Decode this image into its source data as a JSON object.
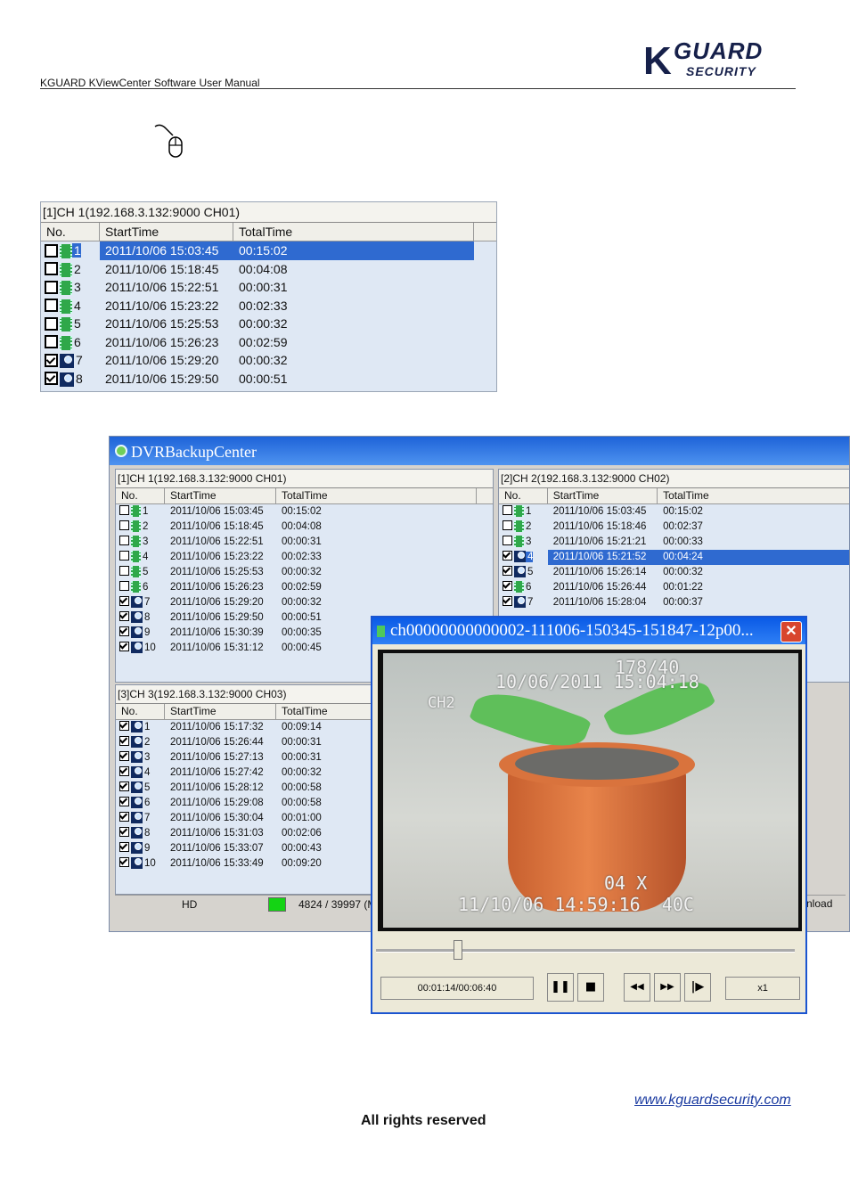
{
  "header": {
    "title": "KGUARD KViewCenter Software User Manual",
    "logo_main": "K",
    "logo_guard": "GUARD",
    "logo_security": "SECURITY"
  },
  "icons": {
    "mouse": "mouse-icon"
  },
  "list_panel": {
    "title": "[1]CH 1(192.168.3.132:9000 CH01)",
    "columns": [
      "No.",
      "StartTime",
      "TotalTime"
    ],
    "rows": [
      {
        "no": "1",
        "start": "2011/10/06 15:03:45",
        "total": "00:15:02",
        "checked": false,
        "icon": "film",
        "selected": true
      },
      {
        "no": "2",
        "start": "2011/10/06 15:18:45",
        "total": "00:04:08",
        "checked": false,
        "icon": "film"
      },
      {
        "no": "3",
        "start": "2011/10/06 15:22:51",
        "total": "00:00:31",
        "checked": false,
        "icon": "film"
      },
      {
        "no": "4",
        "start": "2011/10/06 15:23:22",
        "total": "00:02:33",
        "checked": false,
        "icon": "film"
      },
      {
        "no": "5",
        "start": "2011/10/06 15:25:53",
        "total": "00:00:32",
        "checked": false,
        "icon": "film"
      },
      {
        "no": "6",
        "start": "2011/10/06 15:26:23",
        "total": "00:02:59",
        "checked": false,
        "icon": "film"
      },
      {
        "no": "7",
        "start": "2011/10/06 15:29:20",
        "total": "00:00:32",
        "checked": true,
        "icon": "mag"
      },
      {
        "no": "8",
        "start": "2011/10/06 15:29:50",
        "total": "00:00:51",
        "checked": true,
        "icon": "mag"
      }
    ]
  },
  "dvr": {
    "title": "DVRBackupCenter",
    "ch1": {
      "title": "[1]CH 1(192.168.3.132:9000 CH01)",
      "columns": [
        "No.",
        "StartTime",
        "TotalTime"
      ],
      "rows": [
        [
          "1",
          "2011/10/06 15:03:45",
          "00:15:02",
          false,
          "film"
        ],
        [
          "2",
          "2011/10/06 15:18:45",
          "00:04:08",
          false,
          "film"
        ],
        [
          "3",
          "2011/10/06 15:22:51",
          "00:00:31",
          false,
          "film"
        ],
        [
          "4",
          "2011/10/06 15:23:22",
          "00:02:33",
          false,
          "film"
        ],
        [
          "5",
          "2011/10/06 15:25:53",
          "00:00:32",
          false,
          "film"
        ],
        [
          "6",
          "2011/10/06 15:26:23",
          "00:02:59",
          false,
          "film"
        ],
        [
          "7",
          "2011/10/06 15:29:20",
          "00:00:32",
          true,
          "mag"
        ],
        [
          "8",
          "2011/10/06 15:29:50",
          "00:00:51",
          true,
          "mag"
        ],
        [
          "9",
          "2011/10/06 15:30:39",
          "00:00:35",
          true,
          "mag"
        ],
        [
          "10",
          "2011/10/06 15:31:12",
          "00:00:45",
          true,
          "mag"
        ]
      ]
    },
    "ch2": {
      "title": "[2]CH 2(192.168.3.132:9000 CH02)",
      "columns": [
        "No.",
        "StartTime",
        "TotalTime"
      ],
      "rows": [
        [
          "1",
          "2011/10/06 15:03:45",
          "00:15:02",
          false,
          "film"
        ],
        [
          "2",
          "2011/10/06 15:18:46",
          "00:02:37",
          false,
          "film"
        ],
        [
          "3",
          "2011/10/06 15:21:21",
          "00:00:33",
          false,
          "film"
        ],
        [
          "4",
          "2011/10/06 15:21:52",
          "00:04:24",
          true,
          "mag"
        ],
        [
          "5",
          "2011/10/06 15:26:14",
          "00:00:32",
          true,
          "mag"
        ],
        [
          "6",
          "2011/10/06 15:26:44",
          "00:01:22",
          true,
          "film"
        ],
        [
          "7",
          "2011/10/06 15:28:04",
          "00:00:37",
          true,
          "mag"
        ]
      ]
    },
    "ch3": {
      "title": "[3]CH 3(192.168.3.132:9000 CH03)",
      "columns": [
        "No.",
        "StartTime",
        "TotalTime"
      ],
      "rows": [
        [
          "1",
          "2011/10/06 15:17:32",
          "00:09:14",
          true,
          "mag"
        ],
        [
          "2",
          "2011/10/06 15:26:44",
          "00:00:31",
          true,
          "mag"
        ],
        [
          "3",
          "2011/10/06 15:27:13",
          "00:00:31",
          true,
          "mag"
        ],
        [
          "4",
          "2011/10/06 15:27:42",
          "00:00:32",
          true,
          "mag"
        ],
        [
          "5",
          "2011/10/06 15:28:12",
          "00:00:58",
          true,
          "mag"
        ],
        [
          "6",
          "2011/10/06 15:29:08",
          "00:00:58",
          true,
          "mag"
        ],
        [
          "7",
          "2011/10/06 15:30:04",
          "00:01:00",
          true,
          "mag"
        ],
        [
          "8",
          "2011/10/06 15:31:03",
          "00:02:06",
          true,
          "mag"
        ],
        [
          "9",
          "2011/10/06 15:33:07",
          "00:00:43",
          true,
          "mag"
        ],
        [
          "10",
          "2011/10/06 15:33:49",
          "00:09:20",
          true,
          "mag"
        ]
      ]
    },
    "status": {
      "drive": "HD",
      "counter": "4824 / 39997 (M",
      "download": "nload"
    }
  },
  "player": {
    "title": "ch00000000000002-111006-150345-151847-12p00...",
    "osd_date": "10/06/2011 15:04:18",
    "osd_frame": "178/40",
    "osd_ch": "CH2",
    "osd_cam_id": "04 X",
    "osd_cam_time": "11/10/06 14:59:16  40C",
    "time": "00:01:14/00:06:40",
    "speed": "x1",
    "close": "✕",
    "buttons": {
      "pause": "❚❚",
      "stop": "■",
      "rewind": "◀◀",
      "forward": "▶▶",
      "step": "|▶"
    },
    "progress": 0.185
  },
  "footer": {
    "url": "www.kguardsecurity.com",
    "rights": "All rights reserved"
  }
}
